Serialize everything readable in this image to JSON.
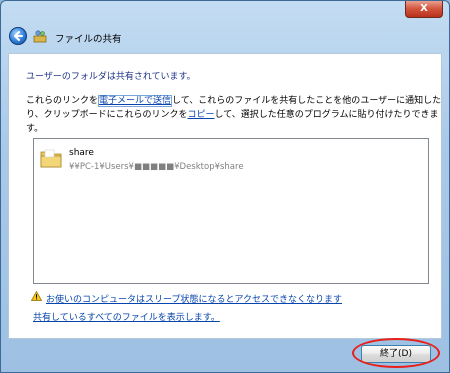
{
  "window": {
    "title": "ファイルの共有",
    "close_label": "X"
  },
  "main": {
    "heading": "ユーザーのフォルダは共有されています。",
    "desc": {
      "part1": "これらのリンクを",
      "email_link": "電子メールで送信",
      "part2": "して、これらのファイルを共有したことを他のユーザーに通知したり、クリップボードにこれらのリンクを",
      "copy_link": "コピー",
      "part3": "して、選択した任意のプログラムに貼り付けたりできます。"
    },
    "shared_items": [
      {
        "name": "share",
        "path": "¥¥PC-1¥Users¥■■■■■¥Desktop¥share"
      }
    ],
    "warning_link": "お使いのコンピュータはスリープ状態になるとアクセスできなくなります",
    "show_all_link": "共有しているすべてのファイルを表示します。"
  },
  "footer": {
    "finish_button": "終了(D)"
  },
  "colors": {
    "heading": "#1e3287",
    "link": "#0645ad",
    "highlight": "#e8201a"
  }
}
